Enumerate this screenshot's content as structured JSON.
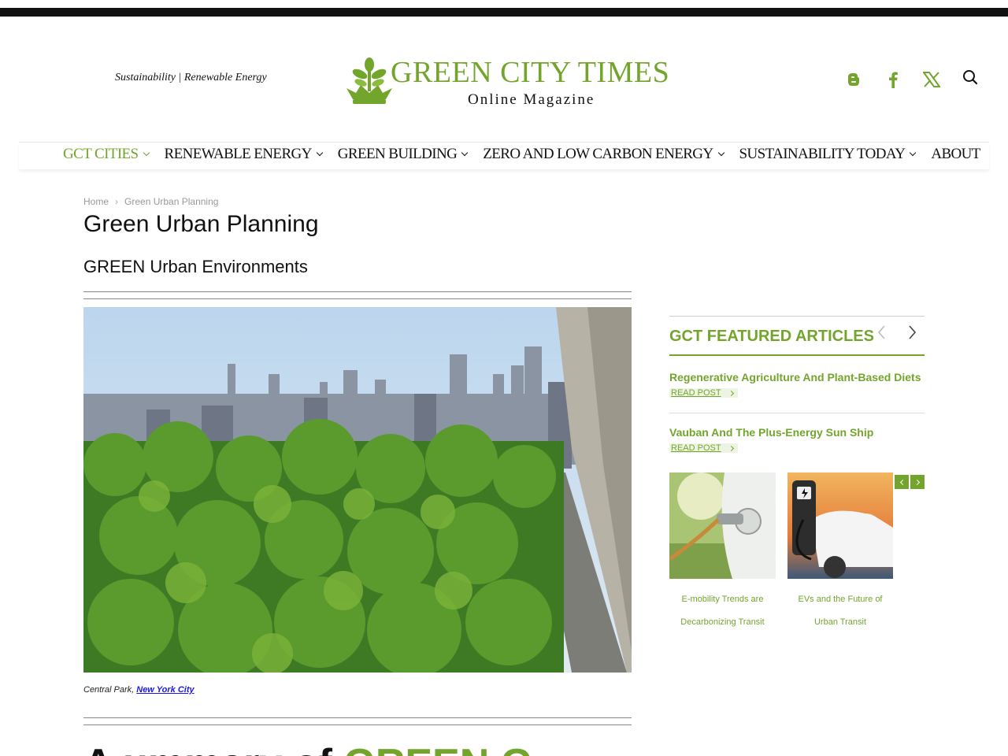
{
  "header": {
    "tagline": "Sustainability | Renewable Energy",
    "logo_title": "GREEN CITY TIMES",
    "logo_subtitle": "Online Magazine",
    "social_icons": [
      "blogger-icon",
      "facebook-icon",
      "x-icon"
    ],
    "search_icon": "search-icon",
    "brand_color": "#73a52d"
  },
  "nav": {
    "items": [
      {
        "label": "GCT CITIES",
        "has_dropdown": true,
        "active": true
      },
      {
        "label": "RENEWABLE ENERGY",
        "has_dropdown": true,
        "active": false
      },
      {
        "label": "GREEN BUILDING",
        "has_dropdown": true,
        "active": false
      },
      {
        "label": "ZERO AND LOW CARBON ENERGY",
        "has_dropdown": true,
        "active": false
      },
      {
        "label": "SUSTAINABILITY TODAY",
        "has_dropdown": true,
        "active": false
      },
      {
        "label": "ABOUT",
        "has_dropdown": false,
        "active": false
      }
    ]
  },
  "breadcrumb": {
    "home": "Home",
    "separator": "›",
    "current": "Green Urban Planning"
  },
  "main": {
    "title": "Green Urban Planning",
    "subtitle": "GREEN Urban Environments",
    "caption_prefix": "Central Park, ",
    "caption_link": "New York City",
    "bottom_heading_start": "A ",
    "bottom_heading_mid": "ummary of ",
    "bottom_heading_green": "GREEN G"
  },
  "sidebar": {
    "featured_title": "GCT FEATURED ARTICLES",
    "articles": [
      {
        "title": "Regenerative Agriculture And Plant-Based Diets",
        "read_label": "READ POST"
      },
      {
        "title": "Vauban And The Plus-Energy Sun Ship",
        "read_label": "READ POST"
      }
    ],
    "cards": [
      {
        "title": "E-mobility Trends are Decarbonizing Transit"
      },
      {
        "title": "EVs and the Future of Urban Transit"
      }
    ]
  }
}
